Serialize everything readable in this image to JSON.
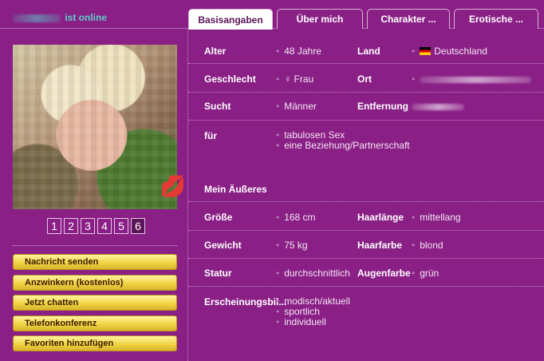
{
  "header": {
    "online_text": "ist online"
  },
  "tabs": [
    {
      "label": "Basisangaben",
      "active": true
    },
    {
      "label": "Über mich",
      "active": false
    },
    {
      "label": "Charakter ...",
      "active": false
    },
    {
      "label": "Erotische ...",
      "active": false
    }
  ],
  "photo": {
    "pages": [
      "1",
      "2",
      "3",
      "4",
      "5",
      "6"
    ],
    "active_page": "6"
  },
  "actions": [
    "Nachricht senden",
    "Anzwinkern (kostenlos)",
    "Jetzt chatten",
    "Telefonkonferenz",
    "Favoriten hinzufügen"
  ],
  "profile": {
    "alter_label": "Alter",
    "alter": "48 Jahre",
    "land_label": "Land",
    "land": "Deutschland",
    "geschlecht_label": "Geschlecht",
    "geschlecht": "♀ Frau",
    "ort_label": "Ort",
    "sucht_label": "Sucht",
    "sucht": "Männer",
    "entfernung_label": "Entfernung",
    "fuer_label": "für",
    "fuer": [
      "tabulosen Sex",
      "eine Beziehung/Partnerschaft"
    ],
    "aeusseres_heading": "Mein Äußeres",
    "groesse_label": "Größe",
    "groesse": "168 cm",
    "haarlaenge_label": "Haarlänge",
    "haarlaenge": "mittellang",
    "gewicht_label": "Gewicht",
    "gewicht": "75 kg",
    "haarfarbe_label": "Haarfarbe",
    "haarfarbe": "blond",
    "statur_label": "Statur",
    "statur": "durchschnittlich",
    "augenfarbe_label": "Augenfarbe",
    "augenfarbe": "grün",
    "erscheinung_label": "Erscheinungsbil...",
    "erscheinung": [
      "modisch/aktuell",
      "sportlich",
      "individuell"
    ]
  },
  "colors": {
    "background": "#8a1f86",
    "button": "#f1d544",
    "online": "#5fd0c8"
  }
}
